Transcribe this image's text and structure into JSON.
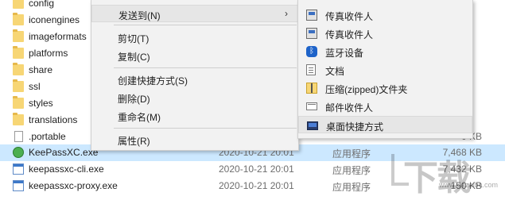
{
  "files": [
    {
      "name": "config",
      "date": "",
      "type": "",
      "size": "",
      "icon": "folder-icon"
    },
    {
      "name": "iconengines",
      "date": "",
      "type": "",
      "size": "",
      "icon": "folder-icon"
    },
    {
      "name": "imageformats",
      "date": "",
      "type": "",
      "size": "",
      "icon": "folder-icon"
    },
    {
      "name": "platforms",
      "date": "",
      "type": "",
      "size": "",
      "icon": "folder-icon"
    },
    {
      "name": "share",
      "date": "",
      "type": "",
      "size": "",
      "icon": "folder-icon"
    },
    {
      "name": "ssl",
      "date": "",
      "type": "",
      "size": "",
      "icon": "folder-icon"
    },
    {
      "name": "styles",
      "date": "",
      "type": "",
      "size": "",
      "icon": "folder-icon"
    },
    {
      "name": "translations",
      "date": "",
      "type": "",
      "size": "",
      "icon": "folder-icon"
    },
    {
      "name": ".portable",
      "date": "",
      "type": "",
      "size": "0 KB",
      "icon": "document-icon"
    },
    {
      "name": "KeePassXC.exe",
      "date": "2020-10-21 20:01",
      "type": "应用程序",
      "size": "7,468 KB",
      "icon": "keepass-icon",
      "selected": true
    },
    {
      "name": "keepassxc-cli.exe",
      "date": "2020-10-21 20:01",
      "type": "应用程序",
      "size": "7,432 KB",
      "icon": "application-icon"
    },
    {
      "name": "keepassxc-proxy.exe",
      "date": "2020-10-21 20:01",
      "type": "应用程序",
      "size": "150 KB",
      "icon": "application-icon"
    }
  ],
  "context_menu": {
    "send_to": "发送到(N)",
    "send_to_arrow": "›",
    "cut": "剪切(T)",
    "copy": "复制(C)",
    "create_shortcut": "创建快捷方式(S)",
    "delete": "删除(D)",
    "rename": "重命名(M)",
    "properties": "属性(R)"
  },
  "send_to_menu": {
    "fax1": "传真收件人",
    "fax2": "传真收件人",
    "bluetooth": "蓝牙设备",
    "documents": "文档",
    "zip": "压缩(zipped)文件夹",
    "mail": "邮件收件人",
    "desktop_shortcut": "桌面快捷方式"
  },
  "watermark": {
    "logo_text": "下载",
    "url": "www.xiazaiba.com"
  }
}
